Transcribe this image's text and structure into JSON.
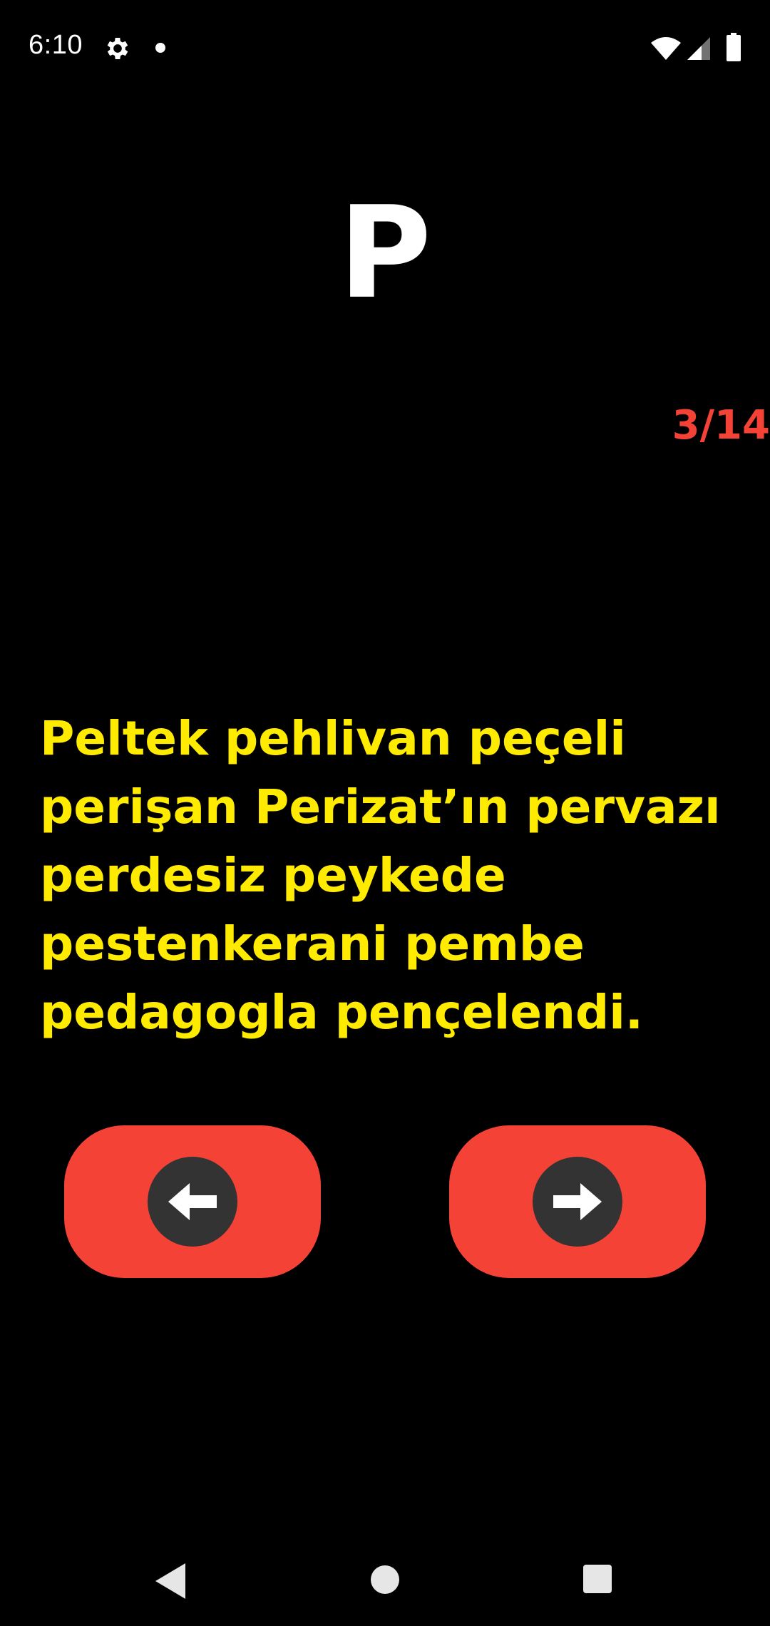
{
  "status_bar": {
    "time": "6:10",
    "icons": [
      "gear-icon",
      "notification-dot-icon",
      "wifi-icon",
      "signal-icon",
      "battery-icon"
    ]
  },
  "letter": "P",
  "counter": "3/14",
  "sentence": "Peltek pehlivan peçeli perişan Perizat’ın pervazı perdesiz peykede pestenkerani pembe pedagogla pençelendi.",
  "buttons": {
    "prev_icon": "arrow-left-icon",
    "next_icon": "arrow-right-icon"
  },
  "colors": {
    "background": "#000000",
    "letter": "#ffffff",
    "counter": "#f44336",
    "sentence": "#ffeb00",
    "button": "#f44336",
    "button_circle": "#333333"
  },
  "system_nav": [
    "back-icon",
    "home-icon",
    "recents-icon"
  ]
}
